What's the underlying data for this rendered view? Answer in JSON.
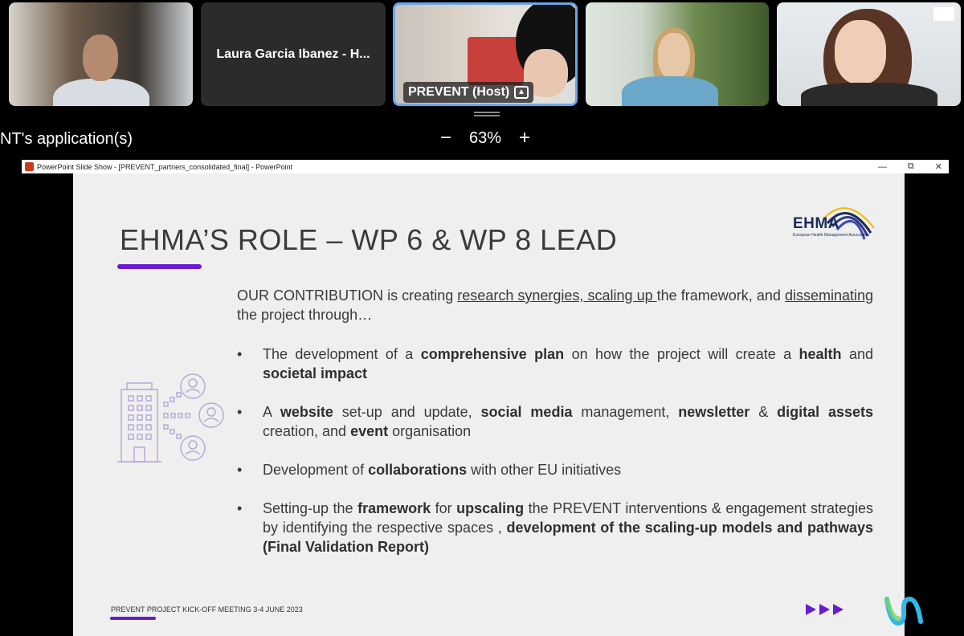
{
  "participants": [
    {
      "name": ""
    },
    {
      "name": "Laura Garcia Ibanez - H..."
    },
    {
      "name": "PREVENT (Host)",
      "role": "host",
      "sharing": true
    },
    {
      "name": ""
    },
    {
      "name": ""
    }
  ],
  "share_toolbar": {
    "app_title": "NT's application(s)",
    "zoom_out": "−",
    "zoom_level": "63%",
    "zoom_in": "+"
  },
  "ppt_window": {
    "title": "PowerPoint Slide Show - [PREVENT_partners_consolidated_final] - PowerPoint",
    "minimize": "—",
    "restore": "⧉",
    "close": "✕"
  },
  "slide": {
    "title": "EHMA’S ROLE – WP 6 & WP 8 LEAD",
    "logo_text": "EHMA",
    "logo_sub": "European Health Management Association",
    "intro": {
      "p1": "OUR CONTRIBUTION is creating ",
      "u1": "research synergies, scaling up ",
      "p2": "the framework, and ",
      "u2": "disseminating",
      "p3": " the project through…"
    },
    "bullets": [
      {
        "parts": [
          "The development of a ",
          "comprehensive plan",
          " on how the project will create a ",
          "health",
          " and ",
          "societal impact",
          ""
        ]
      },
      {
        "parts": [
          "A ",
          "website",
          " set-up and update, ",
          "social media",
          " management, ",
          "newsletter",
          " & ",
          "digital assets",
          " creation, and ",
          "event",
          " organisation"
        ]
      },
      {
        "parts": [
          "Development of ",
          "collaborations",
          " with other EU initiatives"
        ]
      },
      {
        "parts": [
          "Setting-up the ",
          "framework",
          " for ",
          "upscaling",
          " the PREVENT interventions & engagement strategies by identifying the respective spaces , ",
          "development of the scaling-up models and pathways (Final Validation Report)",
          ""
        ]
      }
    ],
    "footer": "PREVENT PROJECT KICK-OFF MEETING 3-4 JUNE 2023"
  },
  "colors": {
    "accent": "#6a1bd0",
    "host_border": "#6aa6e8",
    "ehma_navy": "#1b2a5c"
  }
}
